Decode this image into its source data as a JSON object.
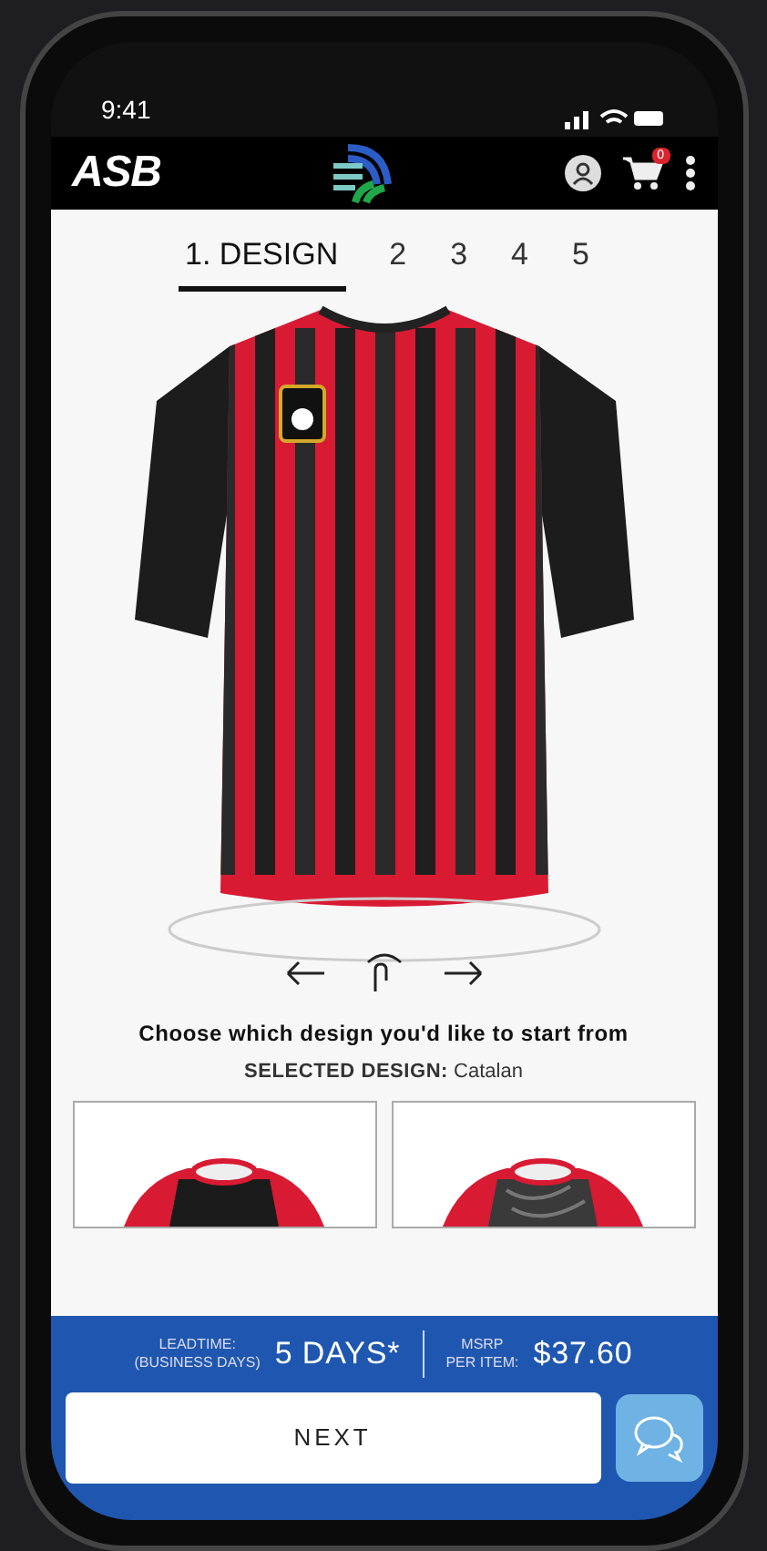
{
  "status_bar": {
    "time": "9:41"
  },
  "header": {
    "logo": "ASB",
    "cart_count": "0"
  },
  "steps": [
    {
      "label": "1. DESIGN",
      "selected": true
    },
    {
      "label": "2",
      "selected": false
    },
    {
      "label": "3",
      "selected": false
    },
    {
      "label": "4",
      "selected": false
    },
    {
      "label": "5",
      "selected": false
    }
  ],
  "prompt": "Choose which design you'd like to start from",
  "selected_design": {
    "label": "SELECTED DESIGN:",
    "value": "Catalan"
  },
  "designs": [
    {
      "kind": "camo",
      "selected": false
    },
    {
      "kind": "swirl",
      "selected": false
    }
  ],
  "footer": {
    "leadtime_label": [
      "LEADTIME:",
      "(BUSINESS DAYS)"
    ],
    "leadtime": "5 DAYS*",
    "msrp_label": [
      "MSRP",
      "PER ITEM:"
    ],
    "price": "$37.60",
    "next": "NEXT"
  }
}
